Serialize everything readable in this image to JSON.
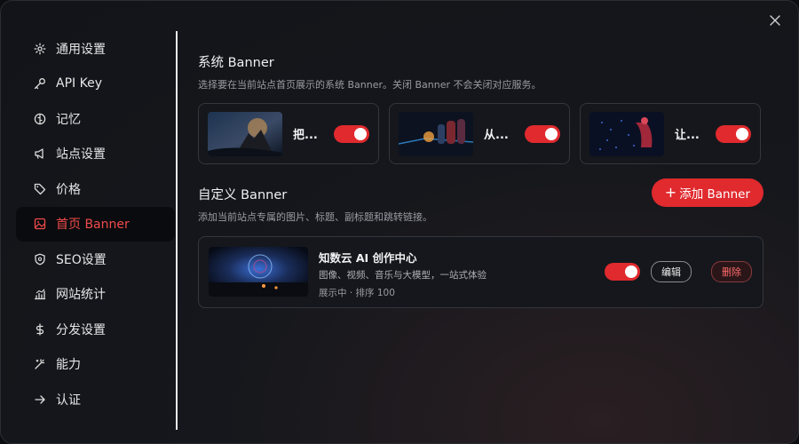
{
  "window": {
    "close_icon": "close-icon"
  },
  "sidebar": {
    "items": [
      {
        "label": "通用设置",
        "icon": "gear-icon"
      },
      {
        "label": "API Key",
        "icon": "key-icon"
      },
      {
        "label": "记忆",
        "icon": "brain-icon"
      },
      {
        "label": "站点设置",
        "icon": "megaphone-icon"
      },
      {
        "label": "价格",
        "icon": "tag-icon"
      },
      {
        "label": "首页 Banner",
        "icon": "image-icon",
        "active": true
      },
      {
        "label": "SEO设置",
        "icon": "shield-icon"
      },
      {
        "label": "网站统计",
        "icon": "bar-chart-icon"
      },
      {
        "label": "分发设置",
        "icon": "dollar-icon"
      },
      {
        "label": "能力",
        "icon": "magic-wand-icon"
      },
      {
        "label": "认证",
        "icon": "arrow-right-icon"
      }
    ]
  },
  "system_banner": {
    "title": "系统 Banner",
    "subtitle": "选择要在当前站点首页展示的系统 Banner。关闭 Banner 不会关闭对应服务。",
    "cards": [
      {
        "label": "把...",
        "enabled": true
      },
      {
        "label": "从...",
        "enabled": true
      },
      {
        "label": "让...",
        "enabled": true
      }
    ]
  },
  "custom_banner": {
    "title": "自定义 Banner",
    "subtitle": "添加当前站点专属的图片、标题、副标题和跳转链接。",
    "add_button": "添加 Banner",
    "items": [
      {
        "title": "知数云 AI 创作中心",
        "subtitle": "图像、视频、音乐与大模型，一站式体验",
        "meta": "展示中 · 排序 100",
        "enabled": true,
        "edit_label": "编辑",
        "delete_label": "删除"
      }
    ]
  },
  "colors": {
    "accent": "#e02a2e",
    "active_text": "#ef4b4b"
  }
}
